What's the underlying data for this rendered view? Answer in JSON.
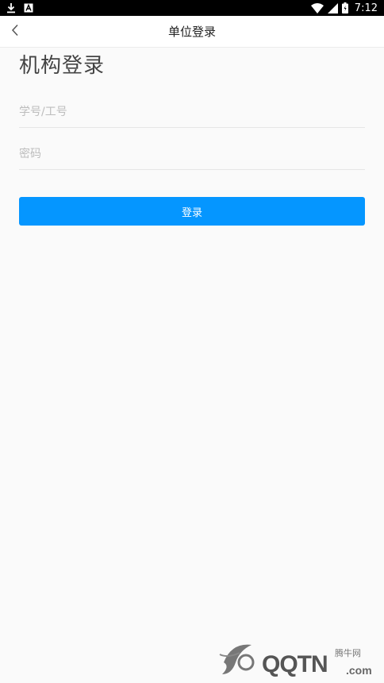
{
  "status_bar": {
    "time": "7:12",
    "icons": [
      "download-icon",
      "notification-a-icon",
      "wifi-icon",
      "signal-icon",
      "battery-icon"
    ]
  },
  "header": {
    "back_icon": "chevron-left-icon",
    "title": "单位登录"
  },
  "main": {
    "heading": "机构登录",
    "account_field": {
      "placeholder": "学号/工号",
      "value": ""
    },
    "password_field": {
      "placeholder": "密码",
      "value": ""
    },
    "login_button": "登录"
  },
  "watermark": {
    "brand": "QQTN",
    "domain": ".com",
    "cn_text": "腾牛网"
  },
  "colors": {
    "accent": "#0596ff",
    "background": "#fafafa",
    "status_bar": "#000000"
  }
}
